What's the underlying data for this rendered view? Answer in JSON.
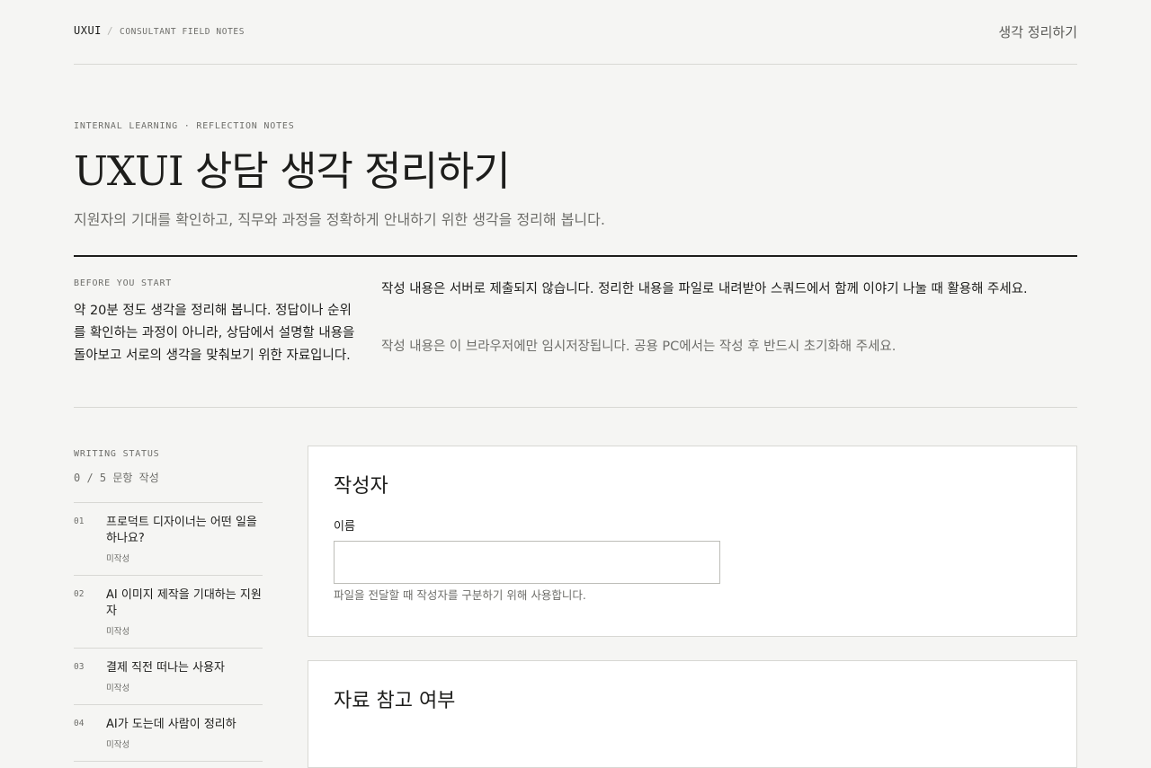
{
  "header": {
    "brand": "UXUI",
    "separator": "/",
    "brand_sub": "CONSULTANT FIELD NOTES",
    "nav_link": "생각 정리하기"
  },
  "hero": {
    "eyebrow": "INTERNAL LEARNING · REFLECTION NOTES",
    "title": "UXUI 상담 생각 정리하기",
    "subtitle": "지원자의 기대를 확인하고, 직무와 과정을 정확하게 안내하기 위한 생각을 정리해 봅니다."
  },
  "intro": {
    "label": "BEFORE YOU START",
    "left_text": "약 20분 정도 생각을 정리해 봅니다. 정답이나 순위를 확인하는 과정이 아니라, 상담에서 설명할 내용을 돌아보고 서로의 생각을 맞춰보기 위한 자료입니다.",
    "right_text_1": "작성 내용은 서버로 제출되지 않습니다. 정리한 내용을 파일로 내려받아 스쿼드에서 함께 이야기 나눌 때 활용해 주세요.",
    "right_text_2": "작성 내용은 이 브라우저에만 임시저장됩니다. 공용 PC에서는 작성 후 반드시 초기화해 주세요."
  },
  "status": {
    "label": "WRITING STATUS",
    "count": "0 / 5 문항 작성"
  },
  "questions": [
    {
      "num": "01",
      "title": "프로덕트 디자이너는 어떤 일을 하나요?",
      "state": "미작성"
    },
    {
      "num": "02",
      "title": "AI 이미지 제작을 기대하는 지원자",
      "state": "미작성"
    },
    {
      "num": "03",
      "title": "결제 직전 떠나는 사용자",
      "state": "미작성"
    },
    {
      "num": "04",
      "title": "AI가 도는데 사람이 정리하",
      "state": "미작성"
    }
  ],
  "author_card": {
    "title": "작성자",
    "field_label": "이름",
    "field_value": "",
    "help": "파일을 전달할 때 작성자를 구분하기 위해 사용합니다."
  },
  "ref_card": {
    "title": "자료 참고 여부"
  }
}
